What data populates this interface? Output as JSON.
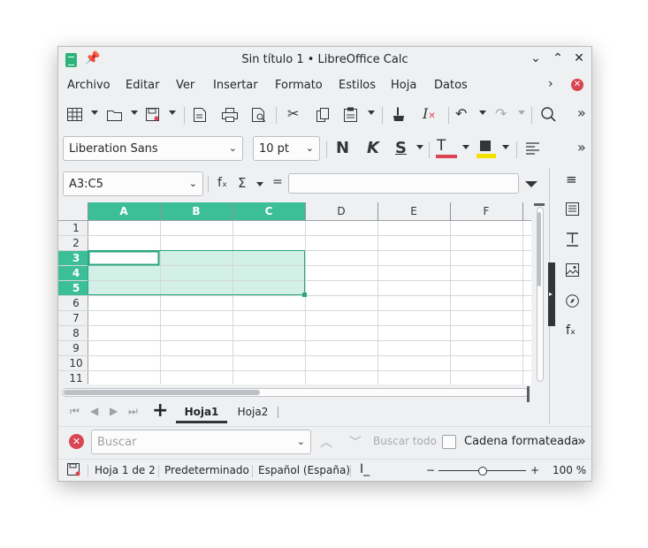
{
  "window": {
    "title": "Sin título 1 • LibreOffice Calc"
  },
  "menu": [
    "Archivo",
    "Editar",
    "Ver",
    "Insertar",
    "Formato",
    "Estilos",
    "Hoja",
    "Datos"
  ],
  "format_bar": {
    "font_name": "Liberation Sans",
    "font_size": "10 pt",
    "bold_glyph": "N",
    "italic_glyph": "K",
    "underline_glyph": "S",
    "font_color_glyph": "T"
  },
  "formula_bar": {
    "name_box": "A3:C5",
    "fx_glyph": "fₓ",
    "sum_glyph": "Σ",
    "equals_glyph": "="
  },
  "grid": {
    "columns": [
      "A",
      "B",
      "C",
      "D",
      "E",
      "F"
    ],
    "rows": [
      "1",
      "2",
      "3",
      "4",
      "5",
      "6",
      "7",
      "8",
      "9",
      "10",
      "11"
    ],
    "selected_columns": [
      "A",
      "B",
      "C"
    ],
    "selected_rows": [
      "3",
      "4",
      "5"
    ],
    "active_cell": "A3",
    "colors": {
      "selection_header": "#3cbf97",
      "selection_fill": "#d3f0e6",
      "selection_border": "#2aa57f",
      "header_bg": "#eff0f1",
      "grid_line": "#d4d7da"
    }
  },
  "sheets": {
    "tabs": [
      "Hoja1",
      "Hoja2"
    ],
    "active": "Hoja1",
    "add_glyph": "+"
  },
  "find": {
    "placeholder": "Buscar",
    "find_all": "Buscar todo",
    "formatted_label": "Cadena formateada"
  },
  "status": {
    "sheet": "Hoja 1 de 2",
    "style": "Predeterminado",
    "language": "Español (España)",
    "zoom_minus": "−",
    "zoom_plus": "+",
    "zoom": "100 %",
    "zoom_level_percent": 100
  }
}
